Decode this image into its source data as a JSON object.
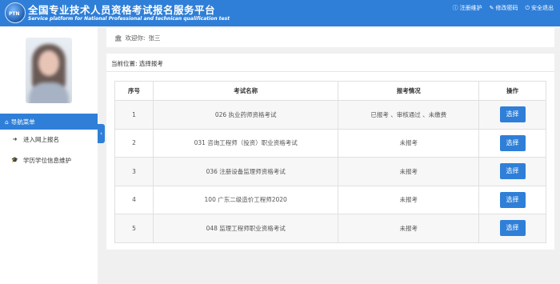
{
  "header": {
    "logo_text": "PTN",
    "title": "全国专业技术人员资格考试报名服务平台",
    "subtitle": "Service platform for National Professional and technican qualification test",
    "links": [
      {
        "icon": "info-icon",
        "glyph": "ⓘ",
        "label": "注册维护"
      },
      {
        "icon": "edit-icon",
        "glyph": "✎",
        "label": "修改密码"
      },
      {
        "icon": "power-icon",
        "glyph": "⏻",
        "label": "安全退出"
      }
    ]
  },
  "sidebar": {
    "nav_title": "导航菜单",
    "items": [
      {
        "icon": "sign-in-icon",
        "glyph": "➜",
        "label": "进入网上报名"
      },
      {
        "icon": "graduation-cap-icon",
        "glyph": "🎓",
        "label": "学历学位信息维护"
      }
    ],
    "collapse_glyph": "‹"
  },
  "welcome": {
    "glyph": "🏛",
    "text": "欢迎你:",
    "name": "张三"
  },
  "breadcrumb": "当前位置:  选择报考",
  "table": {
    "headers": [
      "序号",
      "考试名称",
      "报考情况",
      "操作"
    ],
    "rows": [
      {
        "no": "1",
        "name": "026 执业药师资格考试",
        "status": "已报考 、审核通过 、未缴费",
        "action": "选择"
      },
      {
        "no": "2",
        "name": "031 咨询工程师（投资）职业资格考试",
        "status": "未报考",
        "action": "选择"
      },
      {
        "no": "3",
        "name": "036 注册设备监理师资格考试",
        "status": "未报考",
        "action": "选择"
      },
      {
        "no": "4",
        "name": "100 广东二级造价工程师2020",
        "status": "未报考",
        "action": "选择"
      },
      {
        "no": "5",
        "name": "048 监理工程师职业资格考试",
        "status": "未报考",
        "action": "选择"
      }
    ]
  },
  "colors": {
    "accent": "#2f7fd8",
    "background": "#f0f0f0"
  }
}
